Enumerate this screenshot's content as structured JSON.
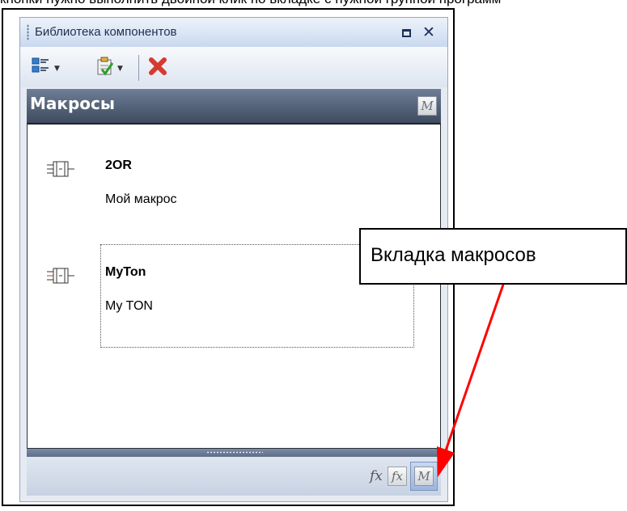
{
  "top_clipped_text": "кнопки нужно выполнить двойной клик по вкладке с нужной группой программ",
  "panel": {
    "title": "Библиотека компонентов",
    "restore_label": "□",
    "close_label": "✕",
    "toolbar": {
      "items": [
        "list-view-icon",
        "properties-icon",
        "delete-icon"
      ]
    },
    "section_title": "Макросы",
    "section_badge": "M",
    "macros": [
      {
        "name": "2OR",
        "description": "Мой макрос",
        "icon": "macro-block-icon",
        "selected": false
      },
      {
        "name": "MyTon",
        "description": "My TON",
        "icon": "macro-block-icon",
        "selected": true
      }
    ],
    "bottom_tabs": {
      "fx_label": "fx",
      "fx_box_label": "fx",
      "macro_tab_label": "M"
    }
  },
  "annotation": {
    "callout_text": "Вкладка макросов",
    "arrow_color": "#ff0000"
  },
  "colors": {
    "header_dark": "#3e4b5f",
    "delete_red": "#d63a2f",
    "active_tab": "#9cb6df"
  }
}
